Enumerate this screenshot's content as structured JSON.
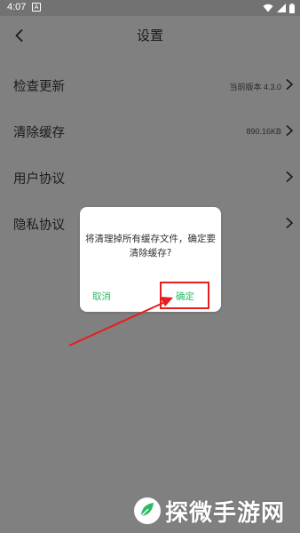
{
  "status_bar": {
    "time": "4:07",
    "notification_badge": "A",
    "icons": [
      "wifi-icon",
      "signal-icon",
      "battery-icon"
    ]
  },
  "header": {
    "title": "设置",
    "back_icon": "chevron-left-icon"
  },
  "settings": {
    "items": [
      {
        "label": "检查更新",
        "value": "当前版本 4.3.0"
      },
      {
        "label": "清除缓存",
        "value": "890.16KB"
      },
      {
        "label": "用户协议",
        "value": ""
      },
      {
        "label": "隐私协议",
        "value": ""
      }
    ]
  },
  "dialog": {
    "message": "将清理掉所有缓存文件，确定要清除缓存?",
    "cancel_label": "取消",
    "confirm_label": "确定"
  },
  "colors": {
    "accent_green": "#2dbb64",
    "highlight_red": "#e81c1c",
    "overlay_gray": "#808080"
  },
  "watermark": {
    "text": "探微手游网"
  }
}
